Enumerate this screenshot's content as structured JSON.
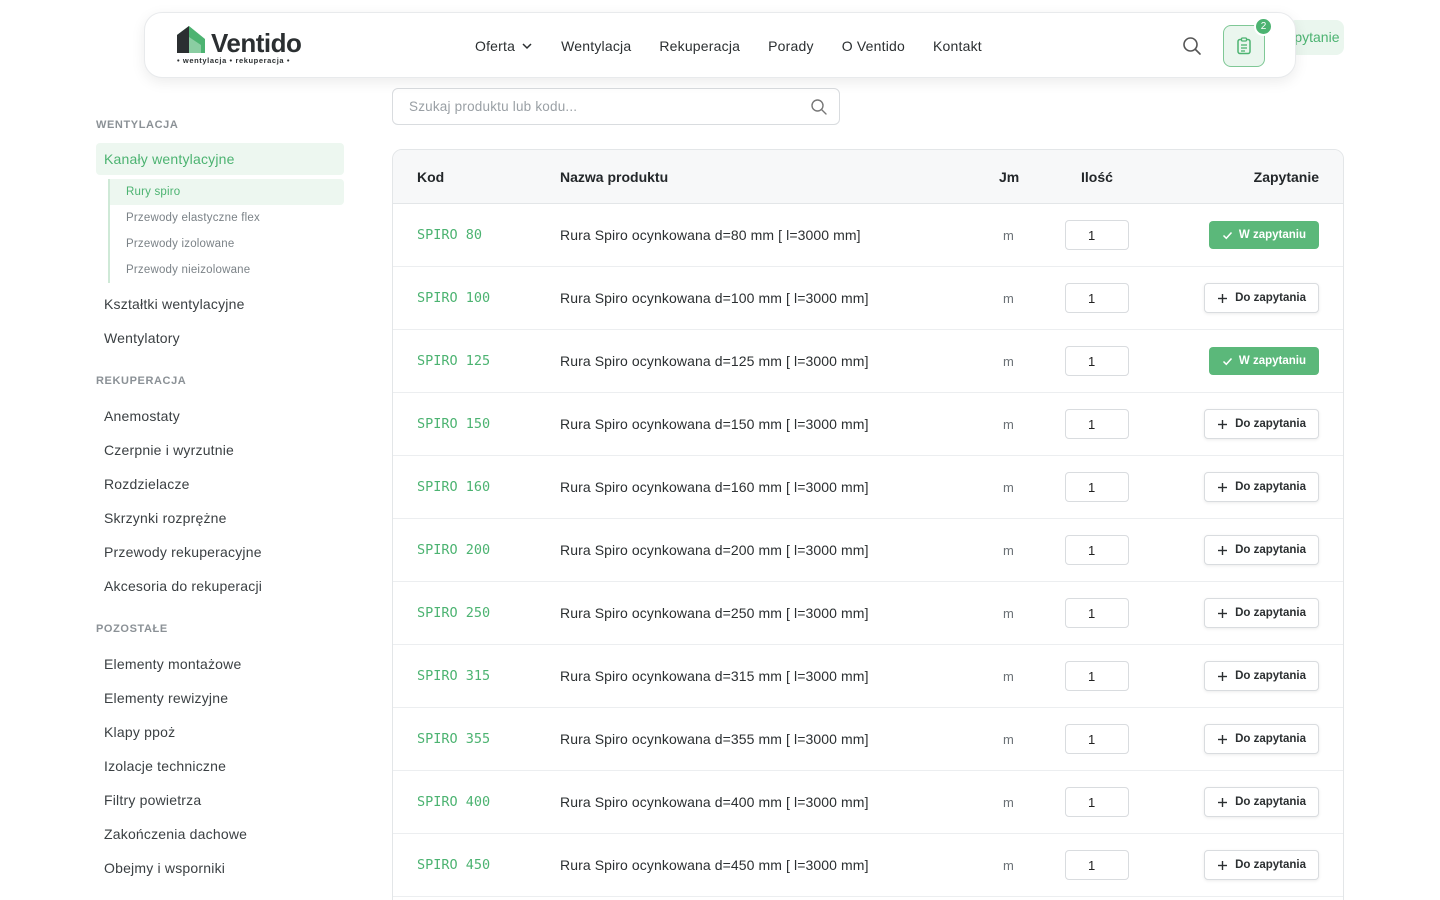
{
  "header": {
    "logo_text": "Ventido",
    "logo_tagline": "• wentylacja • rekuperacja •",
    "nav": [
      "Oferta",
      "Wentylacja",
      "Rekuperacja",
      "Porady",
      "O Ventido",
      "Kontakt"
    ],
    "cart_count": "2",
    "behind_button_label": "Zapytanie ofertowe"
  },
  "search": {
    "placeholder": "Szukaj produktu lub kodu..."
  },
  "sidebar": {
    "sections": [
      {
        "title": "WENTYLACJA"
      },
      {
        "title": "REKUPERACJA"
      },
      {
        "title": "POZOSTAŁE"
      }
    ],
    "wentylacja": {
      "active_item": "Kanały wentylacyjne",
      "sub_items": [
        "Rury spiro",
        "Przewody elastyczne flex",
        "Przewody izolowane",
        "Przewody nieizolowane"
      ],
      "items": [
        "Kształtki wentylacyjne",
        "Wentylatory"
      ]
    },
    "rekuperacja": {
      "items": [
        "Anemostaty",
        "Czerpnie i wyrzutnie",
        "Rozdzielacze",
        "Skrzynki rozprężne",
        "Przewody rekuperacyjne",
        "Akcesoria do rekuperacji"
      ]
    },
    "pozostale": {
      "items": [
        "Elementy montażowe",
        "Elementy rewizyjne",
        "Klapy ppoż",
        "Izolacje techniczne",
        "Filtry powietrza",
        "Zakończenia dachowe",
        "Obejmy i wsporniki"
      ]
    }
  },
  "table": {
    "headers": {
      "code": "Kod",
      "name": "Nazwa produktu",
      "unit": "Jm",
      "qty": "Ilość",
      "request": "Zapytanie"
    },
    "btn_in_request": "W zapytaniu",
    "btn_add_request": "Do zapytania",
    "rows": [
      {
        "code": "SPIRO 80",
        "name": "Rura Spiro ocynkowana d=80 mm [ l=3000 mm]",
        "unit": "m",
        "qty": "1",
        "in_request": true
      },
      {
        "code": "SPIRO 100",
        "name": "Rura Spiro ocynkowana d=100 mm [ l=3000 mm]",
        "unit": "m",
        "qty": "1",
        "in_request": false
      },
      {
        "code": "SPIRO 125",
        "name": "Rura Spiro ocynkowana d=125 mm [ l=3000 mm]",
        "unit": "m",
        "qty": "1",
        "in_request": true
      },
      {
        "code": "SPIRO 150",
        "name": "Rura Spiro ocynkowana d=150 mm [ l=3000 mm]",
        "unit": "m",
        "qty": "1",
        "in_request": false
      },
      {
        "code": "SPIRO 160",
        "name": "Rura Spiro ocynkowana d=160 mm [ l=3000 mm]",
        "unit": "m",
        "qty": "1",
        "in_request": false
      },
      {
        "code": "SPIRO 200",
        "name": "Rura Spiro ocynkowana d=200 mm [ l=3000 mm]",
        "unit": "m",
        "qty": "1",
        "in_request": false
      },
      {
        "code": "SPIRO 250",
        "name": "Rura Spiro ocynkowana d=250 mm [ l=3000 mm]",
        "unit": "m",
        "qty": "1",
        "in_request": false
      },
      {
        "code": "SPIRO 315",
        "name": "Rura Spiro ocynkowana d=315 mm [ l=3000 mm]",
        "unit": "m",
        "qty": "1",
        "in_request": false
      },
      {
        "code": "SPIRO 355",
        "name": "Rura Spiro ocynkowana d=355 mm [ l=3000 mm]",
        "unit": "m",
        "qty": "1",
        "in_request": false
      },
      {
        "code": "SPIRO 400",
        "name": "Rura Spiro ocynkowana d=400 mm [ l=3000 mm]",
        "unit": "m",
        "qty": "1",
        "in_request": false
      },
      {
        "code": "SPIRO 450",
        "name": "Rura Spiro ocynkowana d=450 mm [ l=3000 mm]",
        "unit": "m",
        "qty": "1",
        "in_request": false
      }
    ]
  },
  "colors": {
    "accent": "#4cb371",
    "accent_light": "#edf7f0",
    "border": "#e3e6e8"
  }
}
